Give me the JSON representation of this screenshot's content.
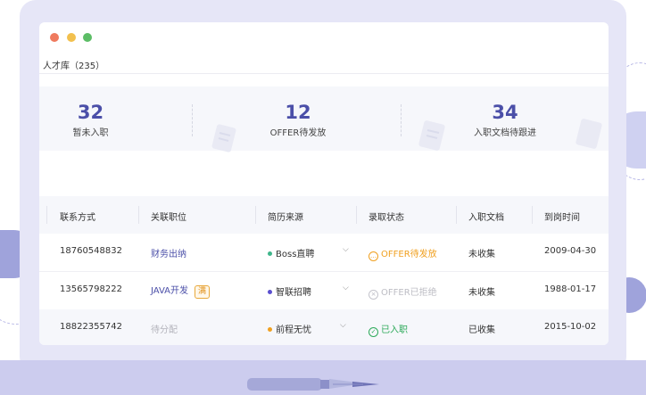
{
  "window": {
    "title": "人才库（235）",
    "traffic_lights": [
      "#ef7a5e",
      "#f2c04e",
      "#5cbd66"
    ]
  },
  "stats": [
    {
      "value": "32",
      "label": "暂未入职"
    },
    {
      "value": "12",
      "label": "OFFER待发放"
    },
    {
      "value": "34",
      "label": "入职文档待跟进"
    }
  ],
  "table": {
    "headers": [
      "联系方式",
      "关联职位",
      "简历来源",
      "录取状态",
      "入职文档",
      "到岗时间"
    ],
    "rows": [
      {
        "phone": "18760548832",
        "position": "财务出纳",
        "position_badge": "",
        "source": "Boss直聘",
        "source_color": "#3fb68b",
        "status": "OFFER待发放",
        "status_icon": "…",
        "status_color": "#f0a020",
        "doc": "未收集",
        "date": "2009-04-30"
      },
      {
        "phone": "13565798222",
        "position": "JAVA开发",
        "position_badge": "满",
        "source": "智联招聘",
        "source_color": "#5a4fcf",
        "status": "OFFER已拒绝",
        "status_icon": "×",
        "status_color": "#bdbdc4",
        "doc": "未收集",
        "date": "1988-01-17"
      },
      {
        "phone": "18822355742",
        "position": "待分配",
        "position_badge": "",
        "source": "前程无忧",
        "source_color": "#f0a020",
        "status": "已入职",
        "status_icon": "✓",
        "status_color": "#2daa5a",
        "doc": "已收集",
        "date": "2015-10-02"
      }
    ]
  }
}
